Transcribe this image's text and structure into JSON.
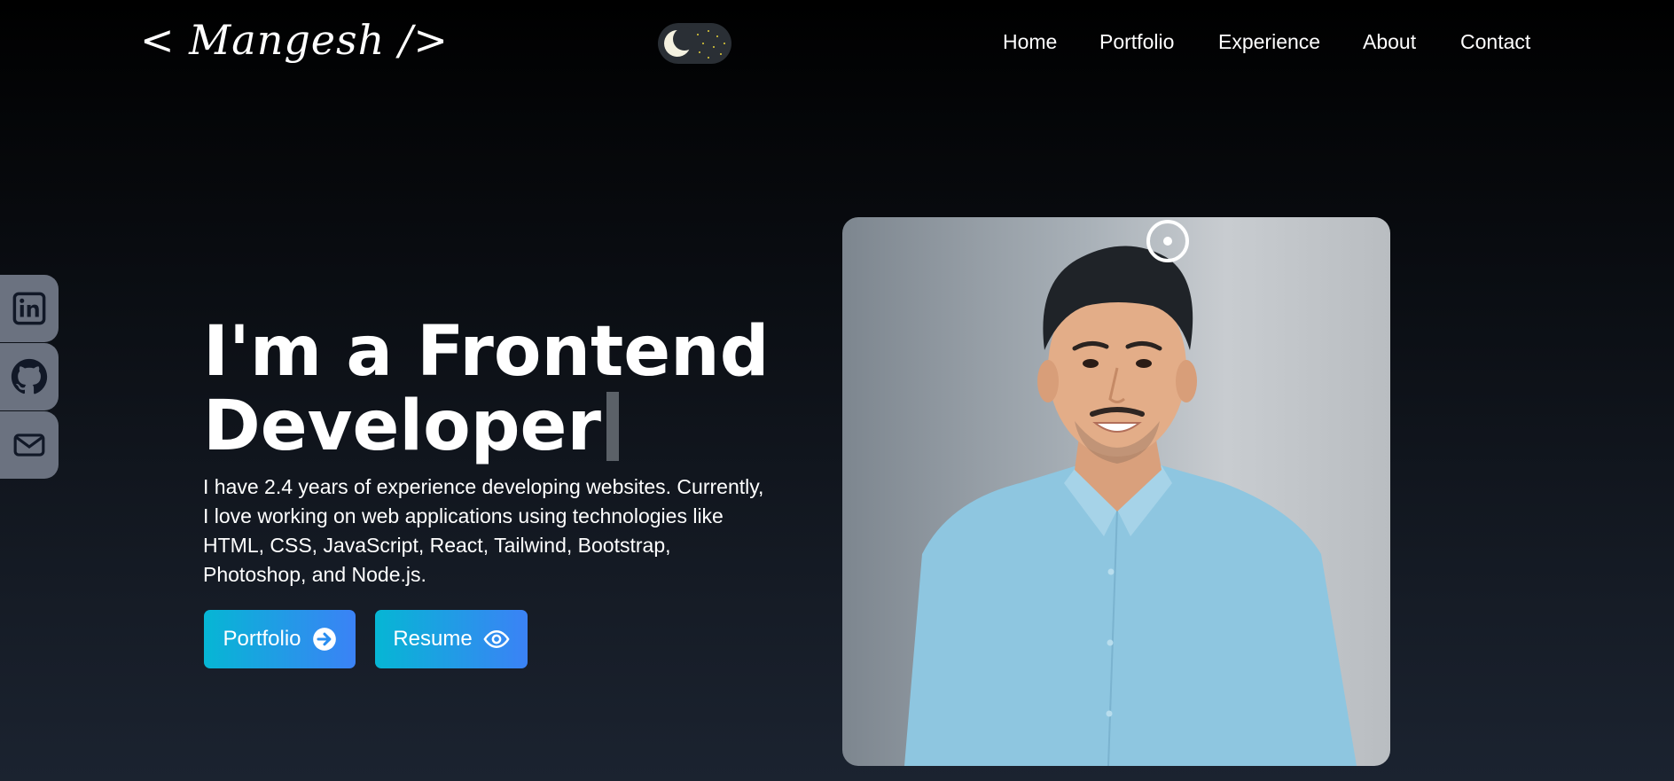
{
  "header": {
    "logo": "< Mangesh />",
    "theme_toggle_icon": "moon-icon",
    "nav": [
      {
        "label": "Home"
      },
      {
        "label": "Portfolio"
      },
      {
        "label": "Experience"
      },
      {
        "label": "About"
      },
      {
        "label": "Contact"
      }
    ]
  },
  "social": [
    {
      "icon": "linkedin-icon"
    },
    {
      "icon": "github-icon"
    },
    {
      "icon": "mail-icon"
    }
  ],
  "hero": {
    "title_line1": "I'm a Frontend",
    "title_line2": "Developer",
    "description": "I have 2.4 years of experience developing websites. Currently, I love working on web applications using technologies like HTML, CSS, JavaScript, React, Tailwind, Bootstrap, Photoshop, and Node.js.",
    "buttons": [
      {
        "label": "Portfolio",
        "icon": "arrow-right-circle-icon"
      },
      {
        "label": "Resume",
        "icon": "eye-icon"
      }
    ]
  },
  "colors": {
    "background_top": "#000000",
    "background_bottom": "#1b2330",
    "button_gradient_start": "#06b6d4",
    "button_gradient_end": "#3b82f6",
    "social_bg": "#6b7280",
    "shirt": "#8ec6e0"
  }
}
